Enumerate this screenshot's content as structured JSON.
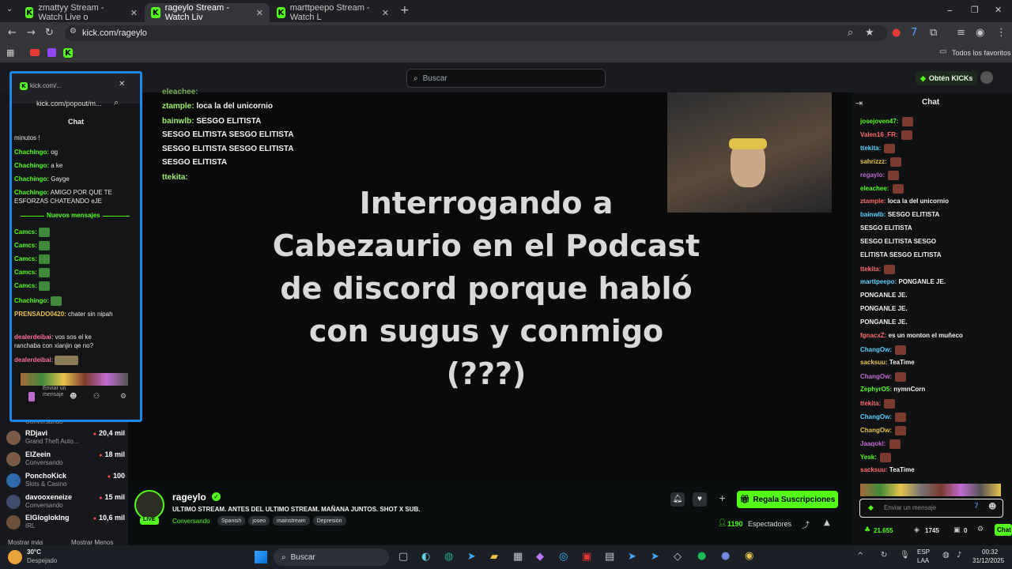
{
  "browser": {
    "tabs": [
      {
        "label": "zmattyy Stream - Watch Live o"
      },
      {
        "label": "rageylo Stream - Watch Liv"
      },
      {
        "label": "marttpeepo Stream - Watch L"
      }
    ],
    "url": "kick.com/rageylo",
    "bookmarks_all": "Todos los favoritos"
  },
  "header": {
    "search_placeholder": "Buscar",
    "kicks_button": "Obtén KICKs"
  },
  "popout": {
    "title": "kick.com/...",
    "url": "kick.com/popout/m...",
    "chat_title": "Chat",
    "new_messages": "Nuevos mensajes",
    "input_placeholder": "Enviar un mensaje",
    "messages": [
      {
        "user": "",
        "text": "minutos !"
      },
      {
        "user": "Chachingo:",
        "text": "og"
      },
      {
        "user": "Chachingo:",
        "text": "a ke"
      },
      {
        "user": "Chachingo:",
        "text": "Gayge"
      },
      {
        "user": "Chachingo:",
        "text": "AMIGO POR QUE TE ESFORZAS CHATEANDO eJE"
      },
      {
        "user": "Camcs:",
        "text": ""
      },
      {
        "user": "Camcs:",
        "text": ""
      },
      {
        "user": "Camcs:",
        "text": ""
      },
      {
        "user": "Camcs:",
        "text": ""
      },
      {
        "user": "Camcs:",
        "text": ""
      },
      {
        "user": "Chachingo:",
        "text": ""
      },
      {
        "user": "PRENSADO0420:",
        "text": "chater sin nipah"
      },
      {
        "user": "dealerdeibai:",
        "text": "vos sos el ke ranchaba con xianjin qe no?"
      },
      {
        "user": "dealerdeibai:",
        "text": ""
      }
    ]
  },
  "sidebar": {
    "channels": [
      {
        "name": "RDjavi",
        "sub": "Grand Theft Auto...",
        "viewers": "20,4 mil"
      },
      {
        "name": "ElZeein",
        "sub": "Conversando",
        "viewers": "18 mil"
      },
      {
        "name": "PonchoKick",
        "sub": "Slots & Casino",
        "viewers": "100"
      },
      {
        "name": "davooxeneize",
        "sub": "Conversando",
        "viewers": "15 mil"
      },
      {
        "name": "ElGloglokIng",
        "sub": "IRL",
        "viewers": "10,6 mil"
      }
    ],
    "partial_sub": "Conversando",
    "show_more": "Mostrar más",
    "show_less": "Mostrar Menos"
  },
  "video": {
    "title_lines": [
      "Interrogando a",
      "Cabezaurio en el Podcast",
      "de discord porque habló",
      "con sugus y conmigo",
      "(???)"
    ],
    "overlay_chat": [
      {
        "user": "eleachee:",
        "text": ""
      },
      {
        "user": "ztample:",
        "text": "loca la del unicornio"
      },
      {
        "user": "bainwlb:",
        "text": "SESGO ELITISTA"
      },
      {
        "user": "",
        "text": "SESGO ELITISTA        SESGO ELITISTA"
      },
      {
        "user": "",
        "text": "SESGO ELITISTA        SESGO ELITISTA"
      },
      {
        "user": "",
        "text": "SESGO ELITISTA"
      },
      {
        "user": "ttekita:",
        "text": ""
      }
    ]
  },
  "stream": {
    "name": "rageylo",
    "title": "ULTIMO STREAM. ANTES DEL ULTIMO STREAM. MAÑANA JUNTOS. SHOT X SUB.",
    "category": "Conversando",
    "tags": [
      "Spanish",
      "joseo",
      "mainstream",
      "Depresión"
    ],
    "gift_button": "Regala Suscripciones",
    "viewers": "1190",
    "viewers_label": "Espectadores",
    "live": "LIVE"
  },
  "chat": {
    "title": "Chat",
    "input_placeholder": "Enviar un mensaje",
    "messages": [
      {
        "user": "josejoven47:",
        "text": ""
      },
      {
        "user": "Valen16_FR:",
        "text": ""
      },
      {
        "user": "ttekita:",
        "text": ""
      },
      {
        "user": "sahrizzz:",
        "text": ""
      },
      {
        "user": "regaylo:",
        "text": ""
      },
      {
        "user": "eleachee:",
        "text": ""
      },
      {
        "user": "ztample:",
        "text": "loca la del unicornio"
      },
      {
        "user": "bainwlb:",
        "text": "SESGO ELITISTA"
      },
      {
        "user": "",
        "text": "SESGO ELITISTA"
      },
      {
        "user": "",
        "text": "SESGO ELITISTA    SESGO"
      },
      {
        "user": "",
        "text": "ELITISTA          SESGO ELITISTA"
      },
      {
        "user": "ttekita:",
        "text": ""
      },
      {
        "user": "marttpeepo:",
        "text": "PONGANLE JE."
      },
      {
        "user": "",
        "text": "PONGANLE JE."
      },
      {
        "user": "",
        "text": "PONGANLE JE."
      },
      {
        "user": "",
        "text": "PONGANLE JE."
      },
      {
        "user": "fgnacxZ:",
        "text": "es un monton el muñeco"
      },
      {
        "user": "ChangOw:",
        "text": ""
      },
      {
        "user": "sacksuu:",
        "text": "TeaTime"
      },
      {
        "user": "ChangOw:",
        "text": ""
      },
      {
        "user": "ZephyrO5:",
        "text": "nymnCorn"
      },
      {
        "user": "ttekita:",
        "text": ""
      },
      {
        "user": "ChangOw:",
        "text": ""
      },
      {
        "user": "ChangOw:",
        "text": ""
      },
      {
        "user": "Jaaqokl:",
        "text": ""
      },
      {
        "user": "Yesk:",
        "text": ""
      },
      {
        "user": "sacksuu:",
        "text": "TeaTime"
      }
    ],
    "points": "21.655",
    "kicks_count": "1745",
    "gift_count": "0",
    "chat_btn": "Chat"
  },
  "taskbar": {
    "temp": "30°C",
    "weather": "Despejado",
    "search": "Buscar",
    "lang1": "ESP",
    "lang2": "LAA",
    "time": "00:32",
    "date": "31/12/2025"
  },
  "colors": {
    "kick_green": "#53fc18",
    "popout_border": "#1e88e5"
  }
}
